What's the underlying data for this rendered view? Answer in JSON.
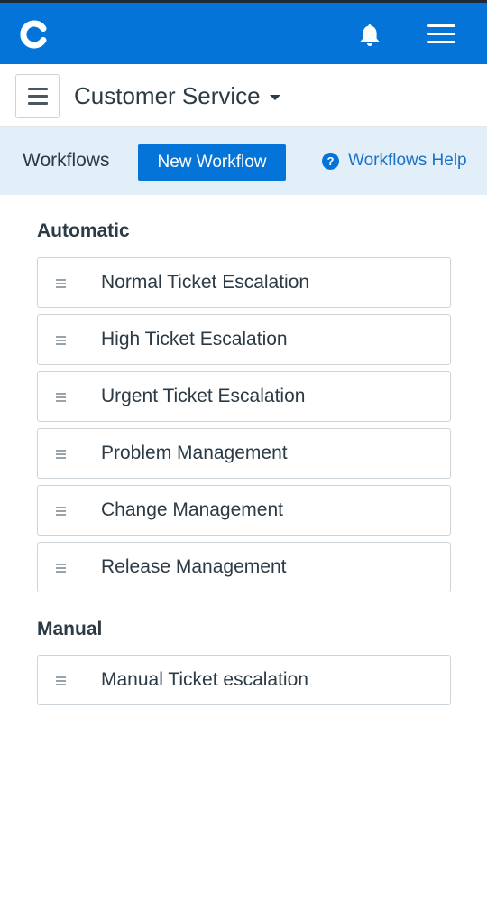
{
  "appbar": {
    "logo_icon": "c-logo-icon",
    "notification_icon": "bell-icon",
    "menu_icon": "hamburger-icon",
    "color": "#0574d9"
  },
  "subheader": {
    "toggle_icon": "hamburger-icon",
    "service": "Customer Service",
    "dropdown_icon": "caret-down-icon"
  },
  "toolbar": {
    "title": "Workflows",
    "new_button": "New Workflow",
    "help_icon": "question-circle-icon",
    "help_label": "Workflows Help",
    "background": "#e2eef8"
  },
  "sections": {
    "automatic": {
      "title": "Automatic",
      "items": [
        "Normal Ticket Escalation",
        "High Ticket Escalation",
        "Urgent Ticket Escalation",
        "Problem Management",
        "Change Management",
        "Release Management"
      ]
    },
    "manual": {
      "title": "Manual",
      "items": [
        "Manual Ticket escalation"
      ]
    }
  },
  "item_icon": "drag-handle-icon"
}
